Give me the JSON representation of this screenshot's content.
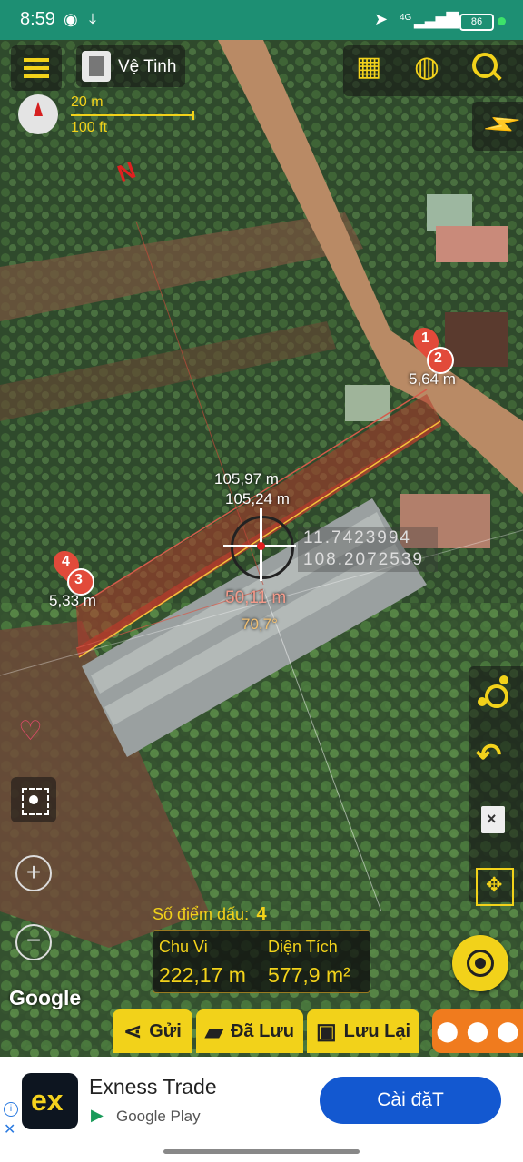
{
  "status_bar": {
    "time": "8:59",
    "network": "4G",
    "battery": "86"
  },
  "map_header": {
    "layer_label": "Vệ Tinh",
    "scale_metric": "20 m",
    "scale_imperial": "100 ft",
    "north_label": "N"
  },
  "measurement": {
    "points": [
      {
        "label": "1"
      },
      {
        "label": "2",
        "distance": "5,64 m"
      },
      {
        "label": "3",
        "distance": "5,33 m"
      },
      {
        "label": "4"
      }
    ],
    "edge_top": "105,97 m",
    "edge_bottom": "105,24 m",
    "center_lat": "11.7423994",
    "center_lng": "108.2072539",
    "cursor_distance": "50,11 m",
    "cursor_angle": "70,7°"
  },
  "summary": {
    "point_count_label": "Số điểm dấu:",
    "point_count": "4",
    "perimeter_label": "Chu Vi",
    "perimeter_value": "222,17 m",
    "area_label": "Diện Tích",
    "area_value": "577,9 m²"
  },
  "map_attribution": "Google",
  "bottom_bar": {
    "send_label": "Gửi",
    "saved_label": "Đã Lưu",
    "save_label": "Lưu Lại"
  },
  "ad": {
    "title": "Exness Trade",
    "store": "Google Play",
    "cta": "Cài đặT",
    "logo_text": "ex"
  },
  "colors": {
    "status_bar": "#1d8f73",
    "accent_yellow": "#f2d21a",
    "polygon_fill": "#c0392b",
    "cta_blue": "#1358d0",
    "pins_orange": "#f07b1e"
  }
}
